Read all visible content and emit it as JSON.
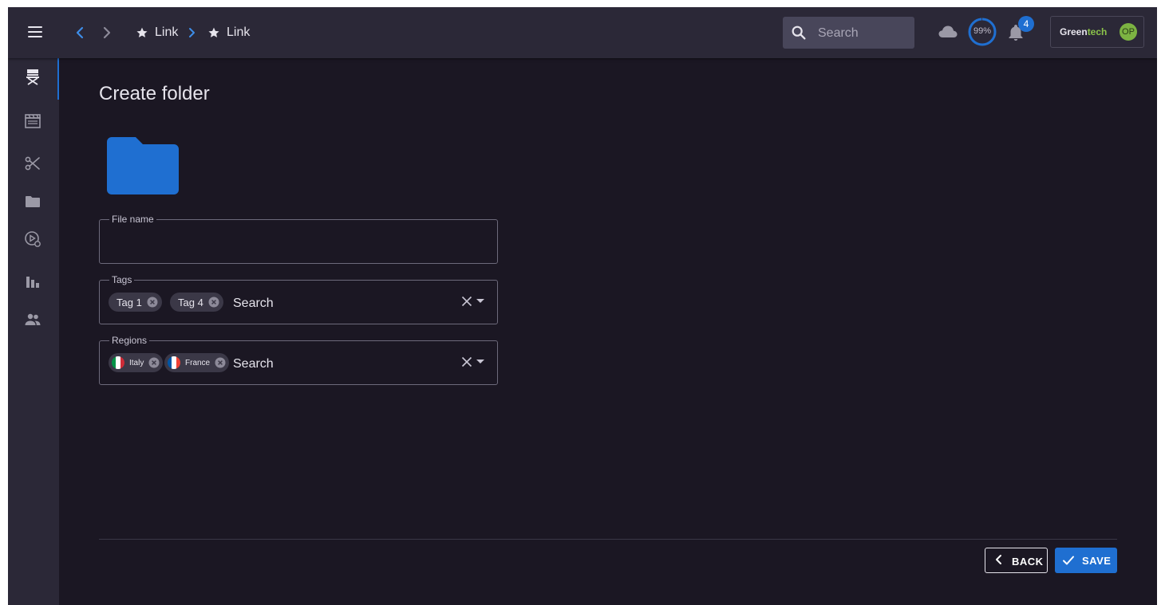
{
  "header": {
    "breadcrumbs": [
      {
        "label": "Link"
      },
      {
        "label": "Link"
      }
    ],
    "search_placeholder": "Search",
    "progress_text": "99%",
    "progress_value": 0.99,
    "notification_count": "4",
    "brand_name_part1": "Green",
    "brand_name_part2": "tech",
    "avatar_initials": "OP"
  },
  "sidebar": {
    "items": [
      {
        "icon": "director-chair-icon",
        "active": true
      },
      {
        "icon": "clapperboard-icon",
        "active": false
      },
      {
        "icon": "scissors-icon",
        "active": false
      },
      {
        "icon": "folder-icon",
        "active": false
      },
      {
        "icon": "film-reel-icon",
        "active": false
      },
      {
        "icon": "bar-chart-icon",
        "active": false
      },
      {
        "icon": "people-icon",
        "active": false
      }
    ]
  },
  "main": {
    "title": "Create folder",
    "fields": {
      "file_name": {
        "label": "File name",
        "value": ""
      },
      "tags": {
        "label": "Tags",
        "chips": [
          "Tag 1",
          "Tag 4"
        ],
        "placeholder": "Search"
      },
      "regions": {
        "label": "Regions",
        "chips": [
          "Italy",
          "France"
        ],
        "placeholder": "Search"
      }
    },
    "actions": {
      "back_label": "BACK",
      "save_label": "SAVE"
    }
  },
  "colors": {
    "background": "#1b1723",
    "surface": "#2b2837",
    "accent": "#1f6fd1",
    "brand_green": "#8bc34a"
  }
}
